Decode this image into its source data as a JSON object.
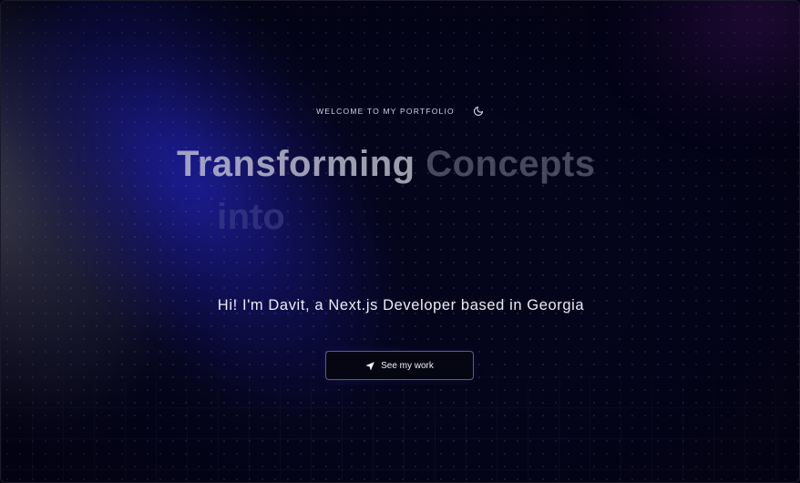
{
  "hero": {
    "eyebrow": "WELCOME TO MY PORTFOLIO",
    "theme_toggle_icon": "moon-icon",
    "headline": {
      "word1": "Transforming",
      "word2": "Concepts",
      "word3": "into"
    },
    "intro": "Hi! I'm Davit, a Next.js Developer based in Georgia",
    "cta": {
      "label": "See my work",
      "icon": "paper-plane-icon"
    }
  },
  "colors": {
    "background": "#04041a",
    "beam_blue": "#2828d2",
    "beam_purple": "#6e1e96",
    "text": "#ececf5",
    "button_border": "#7878b4"
  }
}
